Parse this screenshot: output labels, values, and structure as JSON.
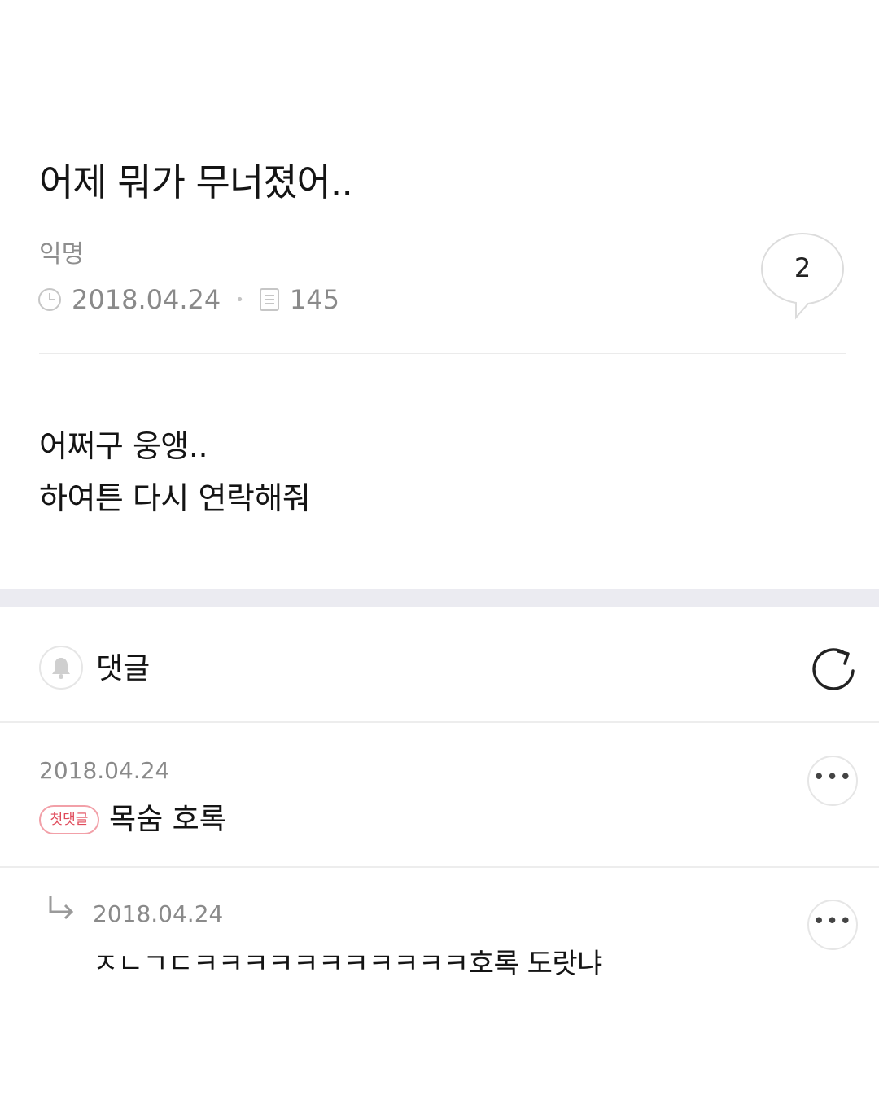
{
  "post": {
    "title": "어제 뭐가 무너졌어..",
    "author": "익명",
    "date": "2018.04.24",
    "views": "145",
    "comment_count": "2",
    "body_lines": [
      "어쩌구 웅앵..",
      "하여튼 다시 연락해줘"
    ]
  },
  "comments_section": {
    "label": "댓글"
  },
  "comments": [
    {
      "date": "2018.04.24",
      "badge": "첫댓글",
      "text": "목숨 호록"
    },
    {
      "date": "2018.04.24",
      "text": "ㅈㄴㄱㄷㅋㅋㅋㅋㅋㅋㅋㅋㅋㅋㅋ호록 도랏냐",
      "is_reply": true
    }
  ],
  "icons": {
    "clock": "clock-icon",
    "views": "document-icon",
    "comment_bubble": "speech-bubble-icon",
    "bell": "bell-icon",
    "refresh": "refresh-icon",
    "more": "more-icon",
    "reply": "reply-arrow-icon"
  },
  "colors": {
    "badge": "#e04a5a",
    "divider": "#ebebf1"
  }
}
